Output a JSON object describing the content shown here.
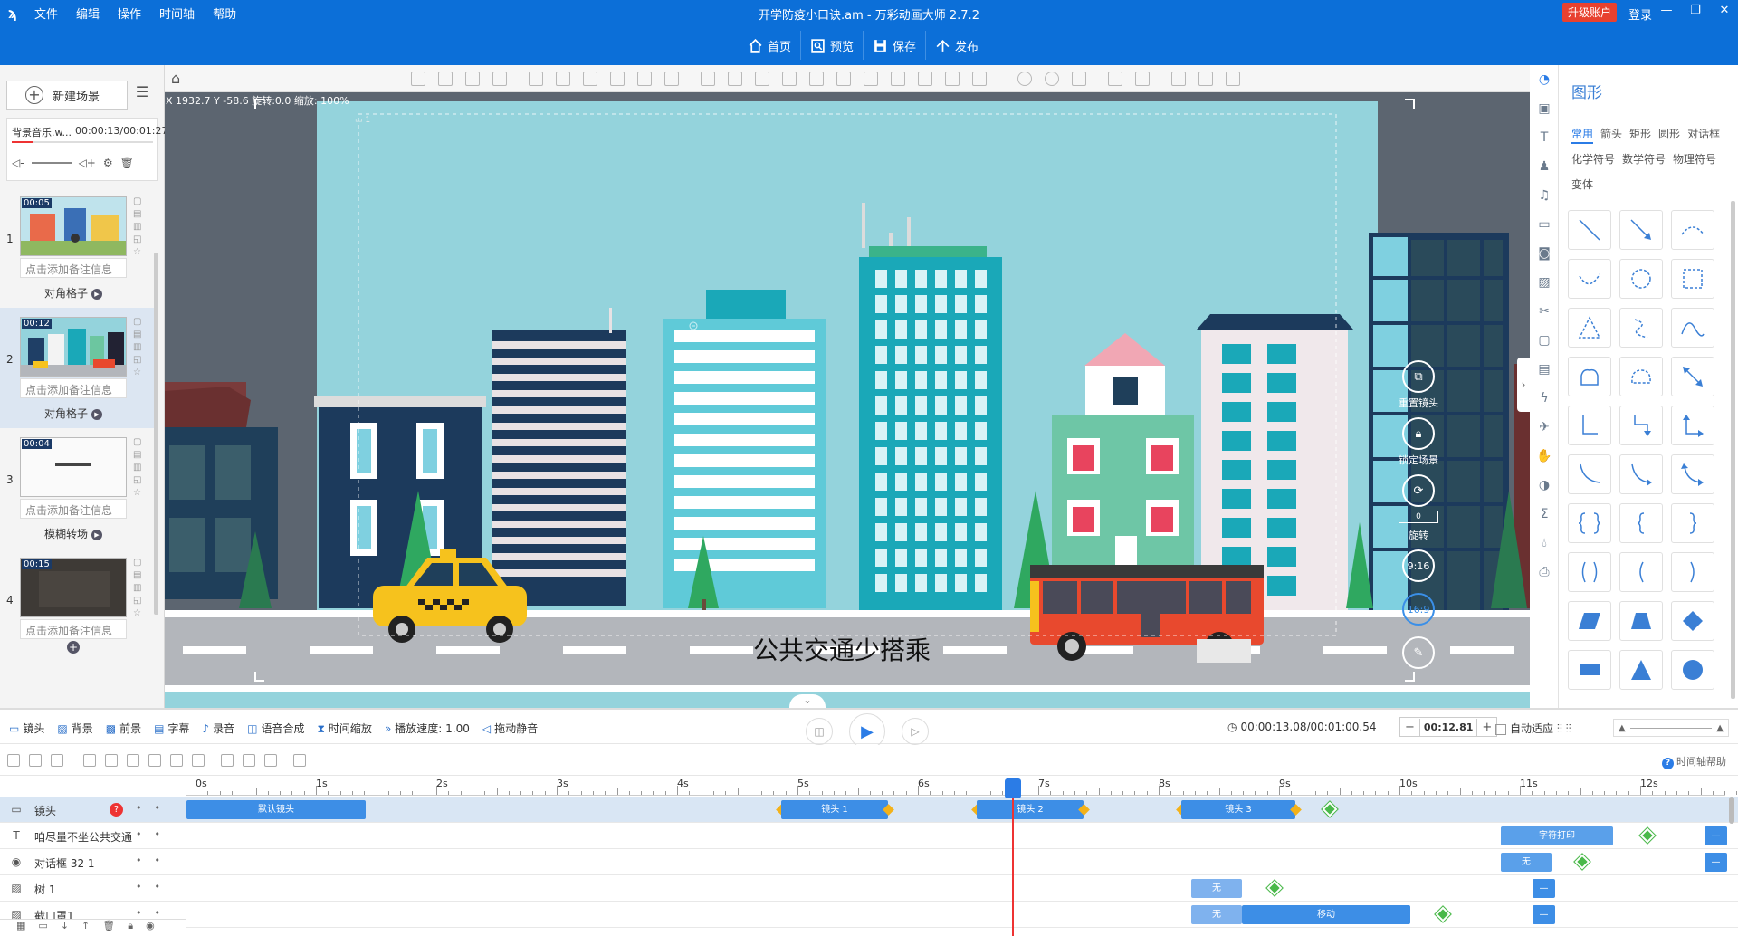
{
  "app": {
    "window_title": "开学防疫小口诀.am - 万彩动画大师 2.7.2",
    "menu": [
      "文件",
      "编辑",
      "操作",
      "时间轴",
      "帮助"
    ],
    "upgrade_label": "升级账户",
    "login_label": "登录",
    "main_toolbar": [
      "首页",
      "预览",
      "保存",
      "发布"
    ]
  },
  "left_panel": {
    "new_scene_label": "新建场景",
    "bgm_name": "背景音乐.w...",
    "bgm_time": "00:00:13/00:01:27",
    "bgm_progress": 0.15,
    "scenes": [
      {
        "num": "1",
        "duration": "00:05",
        "note_placeholder": "点击添加备注信息",
        "transition": "对角格子"
      },
      {
        "num": "2",
        "duration": "00:12",
        "note_placeholder": "点击添加备注信息",
        "transition": "对角格子",
        "selected": true
      },
      {
        "num": "3",
        "duration": "00:04",
        "note_placeholder": "点击添加备注信息",
        "transition": "模糊转场"
      },
      {
        "num": "4",
        "duration": "00:15",
        "note_placeholder": "点击添加备注信息",
        "transition": ""
      }
    ]
  },
  "canvas": {
    "coords": "X 1932.7 Y -58.6 旋转:0.0 缩放: 100%",
    "subtitle": "公共交通少搭乘",
    "camera_label": "1",
    "controls": {
      "reset_camera": "重置镜头",
      "lock_scene": "锁定场景",
      "rotate": "旋转",
      "rotate_value": "0",
      "ratio_916": "9:16",
      "ratio_169": "16:9"
    }
  },
  "right_panel": {
    "title": "图形",
    "tabs": [
      "常用",
      "箭头",
      "矩形",
      "圆形",
      "对话框",
      "化学符号",
      "数学符号",
      "物理符号",
      "变体"
    ],
    "active_tab": "常用"
  },
  "timeline": {
    "toolbar": [
      "镜头",
      "背景",
      "前景",
      "字幕",
      "录音",
      "语音合成",
      "时间缩放",
      "播放速度: 1.00",
      "拖动静音"
    ],
    "time_display": "00:00:13.08/00:01:00.54",
    "current_value": "00:12.81",
    "autofit_label": "自动适应",
    "help_label": "时间轴帮助",
    "ruler": [
      "0s",
      "1s",
      "2s",
      "3s",
      "4s",
      "5s",
      "6s",
      "7s",
      "8s",
      "9s",
      "10s",
      "11s",
      "12s"
    ],
    "tracks": [
      {
        "name": "镜头",
        "clips": [
          "默认镜头",
          "镜头 1",
          "镜头 2",
          "镜头 3"
        ]
      },
      {
        "name": "咱尽量不坐公共交通",
        "clips": [
          "字符打印"
        ]
      },
      {
        "name": "对话框 32 1",
        "clips": [
          "无"
        ]
      },
      {
        "name": "树 1",
        "clips": [
          "无"
        ]
      },
      {
        "name": "截口罩1",
        "clips": [
          "无",
          "移动"
        ]
      }
    ]
  },
  "colors": {
    "accent": "#0c6fd8",
    "clip": "#3d8ee6",
    "playhead": "#e33333",
    "sky": "#94d3dc"
  }
}
